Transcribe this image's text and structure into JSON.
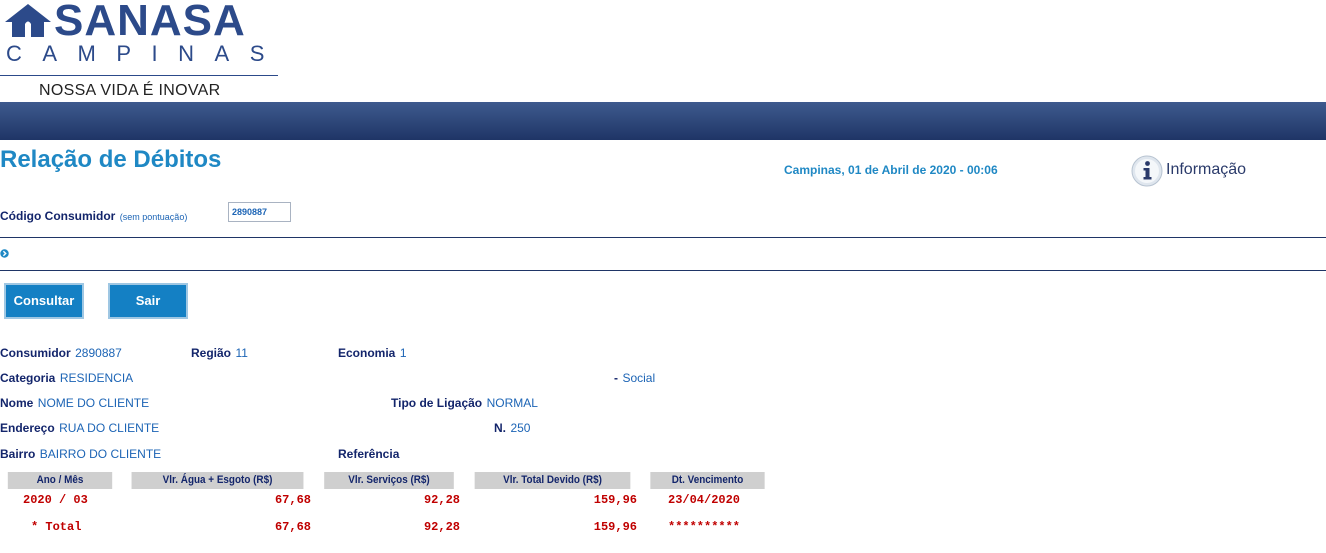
{
  "logo": {
    "wordmark": "SANASA",
    "city": "CAMPINAS",
    "slogan": "NOSSA VIDA É INOVAR"
  },
  "page": {
    "title": "Relação de Débitos",
    "date": "Campinas, 01 de Abril de 2020 - 00:06",
    "info_label": "Informação"
  },
  "form": {
    "code_label": "Código Consumidor",
    "code_hint": "(sem pontuação)",
    "code_value": "2890887"
  },
  "buttons": {
    "consultar": "Consultar",
    "sair": "Sair"
  },
  "details": {
    "consumidor_label": "Consumidor",
    "consumidor_value": "2890887",
    "regiao_label": "Região",
    "regiao_value": "11",
    "economia_label": "Economia",
    "economia_value": "1",
    "categoria_label": "Categoria",
    "categoria_value": "RESIDENCIA",
    "social_dash": "-",
    "social_value": "Social",
    "nome_label": "Nome",
    "nome_value": "NOME DO CLIENTE",
    "tipo_label": "Tipo de Ligação",
    "tipo_value": "NORMAL",
    "endereco_label": "Endereço",
    "endereco_value": "RUA DO CLIENTE",
    "numero_label": "N.",
    "numero_value": "250",
    "bairro_label": "Bairro",
    "bairro_value": "BAIRRO DO CLIENTE",
    "referencia_label": "Referência"
  },
  "table": {
    "headers": [
      "Ano / Mês",
      "Vlr. Água + Esgoto (R$)",
      "Vlr. Serviços (R$)",
      "Vlr. Total Devido (R$)",
      "Dt. Vencimento"
    ],
    "rows": [
      [
        "2020 / 03",
        "67,68",
        "92,28",
        "159,96",
        "23/04/2020"
      ],
      [
        "* Total",
        "67,68",
        "92,28",
        "159,96",
        "**********"
      ]
    ]
  },
  "colors": {
    "brand_blue": "#2c4a8a",
    "title_blue": "#1f88c4",
    "label_navy": "#13256b",
    "value_blue": "#1c64b5",
    "button_blue": "#1480c4",
    "amount_red": "#c00000"
  }
}
